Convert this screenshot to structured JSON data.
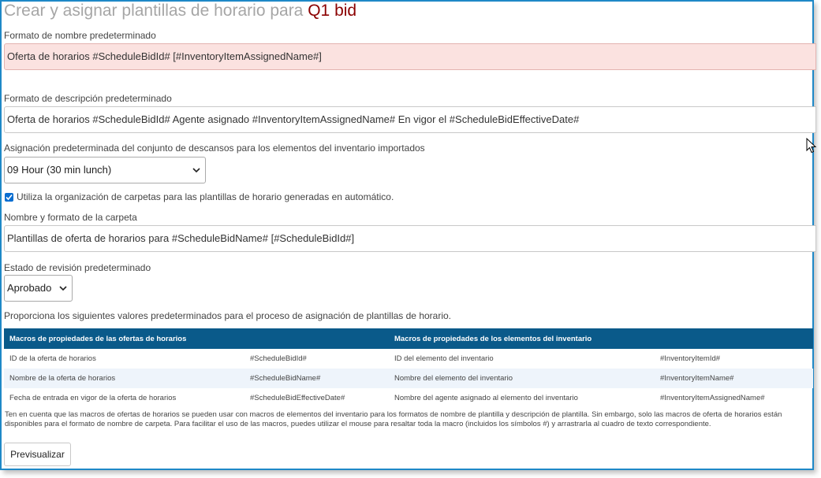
{
  "title": {
    "prefix": "Crear y asignar plantillas de horario para",
    "bid_name": "Q1 bid"
  },
  "name_format": {
    "label": "Formato de nombre predeterminado",
    "value": "Oferta de horarios #ScheduleBidId# [#InventoryItemAssignedName#]"
  },
  "description_format": {
    "label": "Formato de descripción predeterminado",
    "value": "Oferta de horarios #ScheduleBidId# Agente asignado #InventoryItemAssignedName# En vigor el #ScheduleBidEffectiveDate#"
  },
  "break_set": {
    "label": "Asignación predeterminada del conjunto de descansos para los elementos del inventario importados",
    "selected": "09 Hour (30 min lunch)"
  },
  "folder_org": {
    "label": "Utiliza la organización de carpetas para las plantillas de horario generadas en automático.",
    "checked": true
  },
  "folder_format": {
    "label": "Nombre y formato de la carpeta",
    "value": "Plantillas de oferta de horarios para #ScheduleBidName# [#ScheduleBidId#]"
  },
  "review_status": {
    "label": "Estado de revisión predeterminado",
    "selected": "Aprobado"
  },
  "instructions": "Proporciona los siguientes valores predeterminados para el proceso de asignación de plantillas de horario.",
  "macros_table": {
    "headers": [
      "Macros de propiedades de las ofertas de horarios",
      "",
      "Macros de propiedades de los elementos del inventario",
      ""
    ],
    "rows": [
      [
        "ID de la oferta de horarios",
        "#ScheduleBidId#",
        "ID del elemento del inventario",
        "#InventoryItemId#"
      ],
      [
        "Nombre de la oferta de horarios",
        "#ScheduleBidName#",
        "Nombre del elemento del inventario",
        "#InventoryItemName#"
      ],
      [
        "Fecha de entrada en vigor de la oferta de horarios",
        "#ScheduleBidEffectiveDate#",
        "Nombre del agente asignado al elemento del inventario",
        "#InventoryItemAssignedName#"
      ]
    ]
  },
  "note": "Ten en cuenta que las macros de ofertas de horarios se pueden usar con macros de elementos del inventario para los formatos de nombre de plantilla y descripción de plantilla. Sin embargo, solo las macros de oferta de horarios están disponibles para el formato de nombre de carpeta. Para facilitar el uso de las macros, puedes utilizar el mouse para resaltar toda la macro (incluidos los símbolos #) y arrastrarla al cuadro de texto correspondiente.",
  "preview_button": "Previsualizar",
  "colors": {
    "accent": "#0a5a8a",
    "bid_name": "#8b0000",
    "error_bg": "#fbe2e0",
    "checkbox": "#0a6ed1"
  },
  "icons": [
    "chevron-down-icon",
    "check-icon",
    "mouse-cursor-icon"
  ]
}
